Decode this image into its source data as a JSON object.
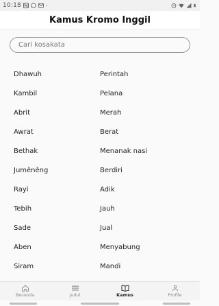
{
  "status_bar": {
    "time": "10:18",
    "left_icons": [
      "notification-n-icon",
      "whatsapp-icon",
      "email-icon",
      "dot-icon"
    ],
    "right_icons": [
      "alarm-icon",
      "wifi-icon",
      "signal-icon",
      "battery-icon"
    ]
  },
  "app_bar": {
    "title": "Kamus Kromo Inggil"
  },
  "search": {
    "placeholder": "Cari kosakata",
    "value": ""
  },
  "entries": [
    {
      "krama": "Dhawuh",
      "english": "Perintah"
    },
    {
      "krama": "Kambil",
      "english": "Pelana"
    },
    {
      "krama": "Abrit",
      "english": "Merah"
    },
    {
      "krama": "Awrat",
      "english": "Berat"
    },
    {
      "krama": "Bethak",
      "english": "Menanak nasi"
    },
    {
      "krama": "Juměněng",
      "english": "Berdiri"
    },
    {
      "krama": "Rayi",
      "english": "Adik"
    },
    {
      "krama": "Tebih",
      "english": "Jauh"
    },
    {
      "krama": "Sade",
      "english": "Jual"
    },
    {
      "krama": "Aben",
      "english": "Menyabung"
    },
    {
      "krama": "Siram",
      "english": "Mandi"
    }
  ],
  "bottom_nav": {
    "items": [
      {
        "label": "Beranda",
        "icon": "home-icon",
        "active": false
      },
      {
        "label": "Judul",
        "icon": "list-icon",
        "active": false
      },
      {
        "label": "Kamus",
        "icon": "book-icon",
        "active": true
      },
      {
        "label": "Profile",
        "icon": "person-icon",
        "active": false
      }
    ]
  },
  "colors": {
    "background": "#fafafa",
    "app_bar": "#ffffff",
    "text": "#222222",
    "nav_inactive": "#8a8a8a",
    "nav_active": "#222222"
  }
}
